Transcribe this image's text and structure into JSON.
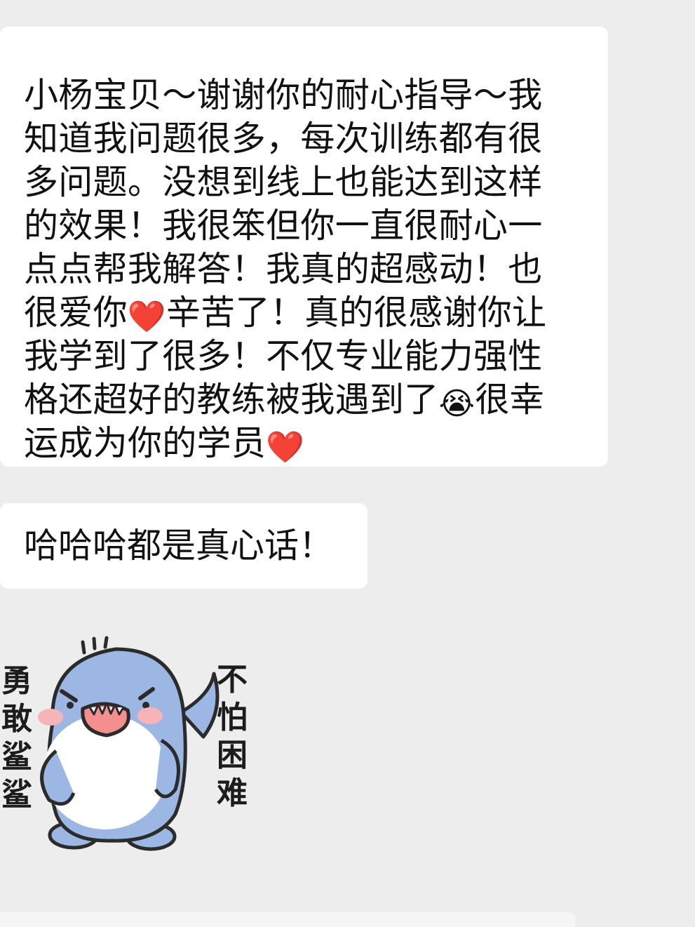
{
  "messages": [
    {
      "segments": [
        "小杨宝贝～谢谢你的耐心指导～我\n知道我问题很多，每次训练都有很\n多问题。没想到线上也能达到这样\n的效果！我很笨但你一直很耐心一\n点点帮我解答！我真的超感动！也\n很爱你",
        "辛苦了！真的很感谢你让\n我学到了很多！不仅专业能力强性\n格还超好的教练被我遇到了",
        "很幸\n运成为你的学员"
      ],
      "emojis": [
        "❤️",
        "😭",
        "❤️"
      ]
    },
    {
      "text": "哈哈哈都是真心话！"
    }
  ],
  "sticker": {
    "icon": "shark-sticker-icon",
    "caption_left": "勇敢鲨鲨",
    "caption_right": "不怕困难",
    "colors": {
      "body": "#9db7e4",
      "belly": "#ffffff",
      "cheek": "#f6b3b8",
      "mouth": "#f38f8f",
      "outline": "#2b2b2b"
    }
  }
}
